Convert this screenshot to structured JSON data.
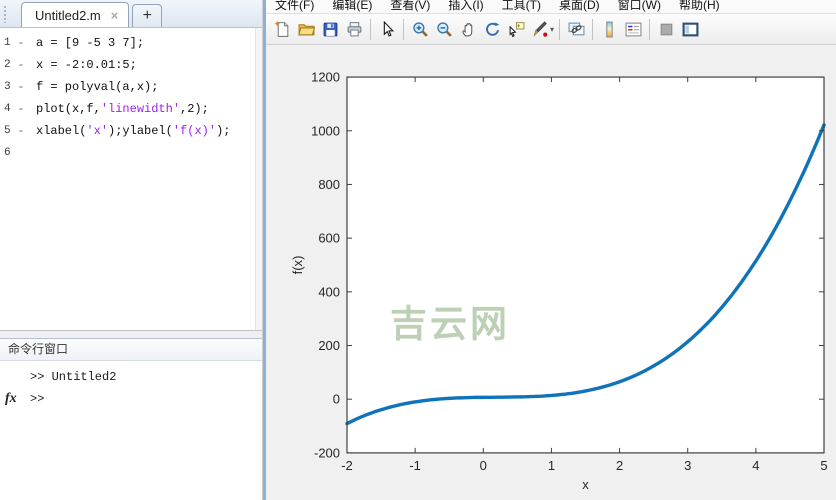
{
  "colors": {
    "figure_background": "#f0f0f0",
    "plot_background": "#ffffff",
    "axis_color": "#404040",
    "tick_label_color": "#262626",
    "string_literal_color": "#a020f0",
    "window_border_accent": "#8bb1d8"
  },
  "editor_panel": {
    "tab": {
      "title": "Untitled2.m",
      "close_icon": "×",
      "new_tab_icon": "+"
    },
    "exec_dash": "-",
    "lines": [
      {
        "num": "1",
        "exec": true,
        "segments": [
          {
            "text": "a = [9 -5 3 7];",
            "type": "code"
          }
        ]
      },
      {
        "num": "2",
        "exec": true,
        "segments": [
          {
            "text": "x = -2:0.01:5;",
            "type": "code"
          }
        ]
      },
      {
        "num": "3",
        "exec": true,
        "segments": [
          {
            "text": "f = polyval(a,x);",
            "type": "code"
          }
        ]
      },
      {
        "num": "4",
        "exec": true,
        "segments": [
          {
            "text": "plot(x,f,",
            "type": "code"
          },
          {
            "text": "'linewidth'",
            "type": "string"
          },
          {
            "text": ",2);",
            "type": "code"
          }
        ]
      },
      {
        "num": "5",
        "exec": true,
        "segments": [
          {
            "text": "xlabel(",
            "type": "code"
          },
          {
            "text": "'x'",
            "type": "string"
          },
          {
            "text": ");ylabel(",
            "type": "code"
          },
          {
            "text": "'f(x)'",
            "type": "string"
          },
          {
            "text": ");",
            "type": "code"
          }
        ]
      },
      {
        "num": "6",
        "exec": false,
        "segments": []
      }
    ],
    "command_window": {
      "header": "命令行窗口",
      "history_line": ">> Untitled2",
      "fx_label": "fx",
      "prompt": ">>"
    }
  },
  "figure_window": {
    "menu_items": [
      {
        "name": "menu-file",
        "label": "文件(F)"
      },
      {
        "name": "menu-edit",
        "label": "编辑(E)"
      },
      {
        "name": "menu-view",
        "label": "查看(V)"
      },
      {
        "name": "menu-insert",
        "label": "插入(I)"
      },
      {
        "name": "menu-tools",
        "label": "工具(T)"
      },
      {
        "name": "menu-desktop",
        "label": "桌面(D)"
      },
      {
        "name": "menu-window",
        "label": "窗口(W)"
      },
      {
        "name": "menu-help",
        "label": "帮助(H)"
      }
    ],
    "toolbar_icons": [
      "new-figure-icon",
      "open-file-icon",
      "save-figure-icon",
      "print-icon",
      "separator",
      "pointer-icon",
      "separator",
      "zoom-in-icon",
      "zoom-out-icon",
      "pan-icon",
      "rotate-3d-icon",
      "data-cursor-icon",
      "brush-icon",
      "separator",
      "link-plots-icon",
      "separator",
      "insert-colorbar-icon",
      "insert-legend-icon",
      "separator",
      "hide-plot-tools-icon",
      "show-plot-tools-icon"
    ],
    "brush_dropdown_caret": "▾"
  },
  "chart_data": {
    "type": "line",
    "title": "",
    "xlabel": "x",
    "ylabel": "f(x)",
    "xlim": [
      -2,
      5
    ],
    "ylim": [
      -200,
      1200
    ],
    "xticks": [
      -2,
      -1,
      0,
      1,
      2,
      3,
      4,
      5
    ],
    "yticks": [
      -200,
      0,
      200,
      400,
      600,
      800,
      1000,
      1200
    ],
    "grid": false,
    "legend": null,
    "polynomial_coefficients": [
      9,
      -5,
      3,
      7
    ],
    "x_sample_step": 0.05,
    "series": [
      {
        "name": "f = polyval(a,x)",
        "color": "#0e73b9",
        "linewidth": 2,
        "points_preview": [
          [
            -2,
            -91
          ],
          [
            -1.5,
            -39.125
          ],
          [
            -1,
            -10
          ],
          [
            -0.5,
            3.125
          ],
          [
            0,
            7
          ],
          [
            0.5,
            8.375
          ],
          [
            1,
            14
          ],
          [
            1.5,
            30.625
          ],
          [
            2,
            65
          ],
          [
            2.5,
            123.875
          ],
          [
            3,
            214
          ],
          [
            3.5,
            342.125
          ],
          [
            4,
            515
          ],
          [
            4.5,
            739.375
          ],
          [
            5,
            1022
          ]
        ]
      }
    ],
    "watermark": {
      "text": "吉云网",
      "color": "#b6ccae"
    }
  }
}
